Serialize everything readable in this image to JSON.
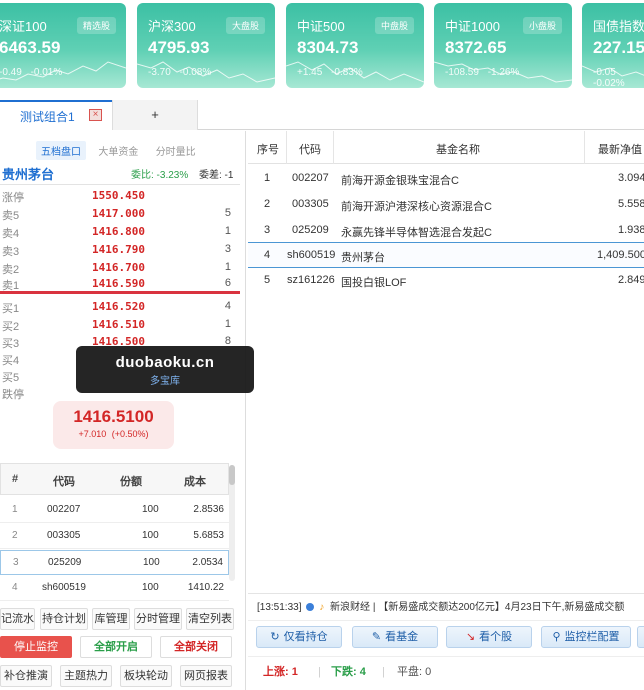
{
  "indices": [
    {
      "name": "深证100",
      "tag": "精选股",
      "value": "6463.59",
      "change": "-0.49",
      "pct": "-0.01%"
    },
    {
      "name": "沪深300",
      "tag": "大盘股",
      "value": "4795.93",
      "change": "-3.70",
      "pct": "-0.08%"
    },
    {
      "name": "中证500",
      "tag": "中盘股",
      "value": "8304.73",
      "change": "+1.45",
      "pct": "-0.83%"
    },
    {
      "name": "中证1000",
      "tag": "小盘股",
      "value": "8372.65",
      "change": "-108.59",
      "pct": "-1.26%"
    },
    {
      "name": "国债指数",
      "tag": "",
      "value": "227.15",
      "change": "-0.05",
      "pct": "-0.02%"
    }
  ],
  "tabs": {
    "active": "测试组合1",
    "close": "×",
    "add": "+"
  },
  "quote": {
    "subtabs": [
      "五档盘口",
      "大单资金",
      "分时量比"
    ],
    "name": "贵州茅台",
    "weibi": "委比: -3.23%",
    "weicha": "委差: -1",
    "limit_up": {
      "label": "涨停",
      "price": "1550.450"
    },
    "sells": [
      {
        "label": "卖5",
        "price": "1417.000",
        "vol": "5"
      },
      {
        "label": "卖4",
        "price": "1416.800",
        "vol": "1"
      },
      {
        "label": "卖3",
        "price": "1416.790",
        "vol": "3"
      },
      {
        "label": "卖2",
        "price": "1416.700",
        "vol": "1"
      },
      {
        "label": "卖1",
        "price": "1416.590",
        "vol": "6"
      }
    ],
    "buys": [
      {
        "label": "买1",
        "price": "1416.520",
        "vol": "4"
      },
      {
        "label": "买2",
        "price": "1416.510",
        "vol": "1"
      },
      {
        "label": "买3",
        "price": "1416.500",
        "vol": "8"
      },
      {
        "label": "买4",
        "price": "",
        "vol": ""
      },
      {
        "label": "买5",
        "price": "",
        "vol": ""
      }
    ],
    "limit_down": {
      "label": "跌停"
    },
    "last": "1416.5100",
    "last_change": "+7.010",
    "last_pct": "(+0.50%)"
  },
  "holdings": {
    "headers": [
      "#",
      "代码",
      "份额",
      "成本"
    ],
    "rows": [
      {
        "idx": "1",
        "code": "002207",
        "qty": "100",
        "cost": "2.8536"
      },
      {
        "idx": "2",
        "code": "003305",
        "qty": "100",
        "cost": "5.6853"
      },
      {
        "idx": "3",
        "code": "025209",
        "qty": "100",
        "cost": "2.0534"
      },
      {
        "idx": "4",
        "code": "sh600519",
        "qty": "100",
        "cost": "1410.22"
      }
    ]
  },
  "left_buttons": {
    "row1": [
      "记流水",
      "持仓计划",
      "库管理",
      "分时管理",
      "清空列表"
    ],
    "row2": [
      "停止监控",
      "全部开启",
      "全部关闭"
    ],
    "row3": [
      "补仓推演",
      "主题热力",
      "板块轮动",
      "网页报表"
    ]
  },
  "fund_table": {
    "headers": [
      "序号",
      "代码",
      "基金名称",
      "最新净值"
    ],
    "rows": [
      {
        "idx": "1",
        "code": "002207",
        "name": "前海开源金银珠宝混合C",
        "nav": "3.094"
      },
      {
        "idx": "2",
        "code": "003305",
        "name": "前海开源沪港深核心资源混合C",
        "nav": "5.558"
      },
      {
        "idx": "3",
        "code": "025209",
        "name": "永赢先锋半导体智选混合发起C",
        "nav": "1.938"
      },
      {
        "idx": "4",
        "code": "sh600519",
        "name": "贵州茅台",
        "nav": "1,409.500"
      },
      {
        "idx": "5",
        "code": "sz161226",
        "name": "国投白银LOF",
        "nav": "2.849"
      }
    ]
  },
  "news": {
    "time": "[13:51:33]",
    "source": "新浪财经",
    "text": "【新易盛成交额达200亿元】4月23日下午,新易盛成交额"
  },
  "actions": [
    {
      "icon": "↻",
      "label": "仅看持仓"
    },
    {
      "icon": "✎",
      "label": "看基金"
    },
    {
      "icon": "↘",
      "label": "看个股"
    },
    {
      "icon": "⚲",
      "label": "监控栏配置"
    }
  ],
  "stats": {
    "up": "上涨: 1",
    "down": "下跌: 4",
    "flat": "平盘: 0"
  },
  "watermark": {
    "domain": "duobaoku.cn",
    "name": "多宝库"
  },
  "colors": {
    "up": "#d32626",
    "down": "#2a9e49",
    "accent": "#1f6fd1",
    "card": "#3cc0a4"
  }
}
